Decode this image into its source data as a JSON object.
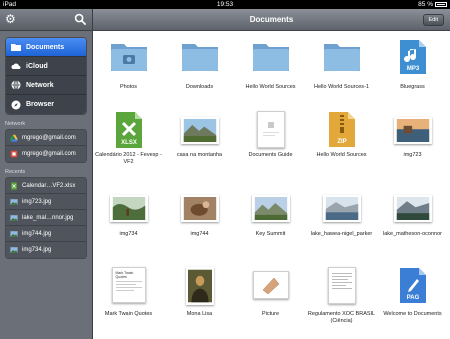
{
  "status": {
    "carrier": "iPad",
    "time": "19:53",
    "battery": "85 %"
  },
  "sidebar": {
    "nav": [
      {
        "label": "Documents",
        "icon": "folder-icon",
        "active": true
      },
      {
        "label": "iCloud",
        "icon": "cloud-icon"
      },
      {
        "label": "Network",
        "icon": "network-icon"
      },
      {
        "label": "Browser",
        "icon": "compass-icon"
      }
    ],
    "network_title": "Network",
    "network": [
      {
        "label": "mgrego@gmail.com",
        "icon": "google-drive-icon"
      },
      {
        "label": "mgrego@gmail.com",
        "icon": "drive-icon"
      }
    ],
    "recents_title": "Recents",
    "recents": [
      {
        "label": "Calendar…VF2.xlsx",
        "icon": "xlsx-file-icon"
      },
      {
        "label": "img723.jpg",
        "icon": "image-file-icon"
      },
      {
        "label": "lake_mal…nnor.jpg",
        "icon": "image-file-icon"
      },
      {
        "label": "img744.jpg",
        "icon": "image-file-icon"
      },
      {
        "label": "img734.jpg",
        "icon": "image-file-icon"
      }
    ]
  },
  "header": {
    "title": "Documents",
    "edit": "Edit"
  },
  "files": [
    {
      "label": "Photos"
    },
    {
      "label": "Downloads"
    },
    {
      "label": "Hello World Sources"
    },
    {
      "label": "Hello World Sources-1"
    },
    {
      "label": "Bluegrass",
      "badge": "MP3"
    },
    {
      "label": "Calendário 2012 - Fevesp - VF2",
      "badge": "XLSX"
    },
    {
      "label": "casa na montanha"
    },
    {
      "label": "Documents Guide"
    },
    {
      "label": "Hello World Sources",
      "badge": "ZIP"
    },
    {
      "label": "img723"
    },
    {
      "label": "img734"
    },
    {
      "label": "img744"
    },
    {
      "label": "Key Summit"
    },
    {
      "label": "lake_hawea-nigel_parker"
    },
    {
      "label": "lake_matheson-oconnor"
    },
    {
      "label": "Mark Twain Quotes",
      "doc_title": "Mark Twain Quotes"
    },
    {
      "label": "Mona Lisa"
    },
    {
      "label": "Picture"
    },
    {
      "label": "Regulamento XOC BRASIL (Ciência)"
    },
    {
      "label": "Welcome to Documents",
      "badge": "PAG"
    }
  ],
  "colors": {
    "accent": "#2a6fe0",
    "folder": "#7fb1db",
    "xlsx": "#5aa53c",
    "zip": "#e2a93a",
    "mp3": "#3d8fd1",
    "pag": "#3a7fd5"
  }
}
